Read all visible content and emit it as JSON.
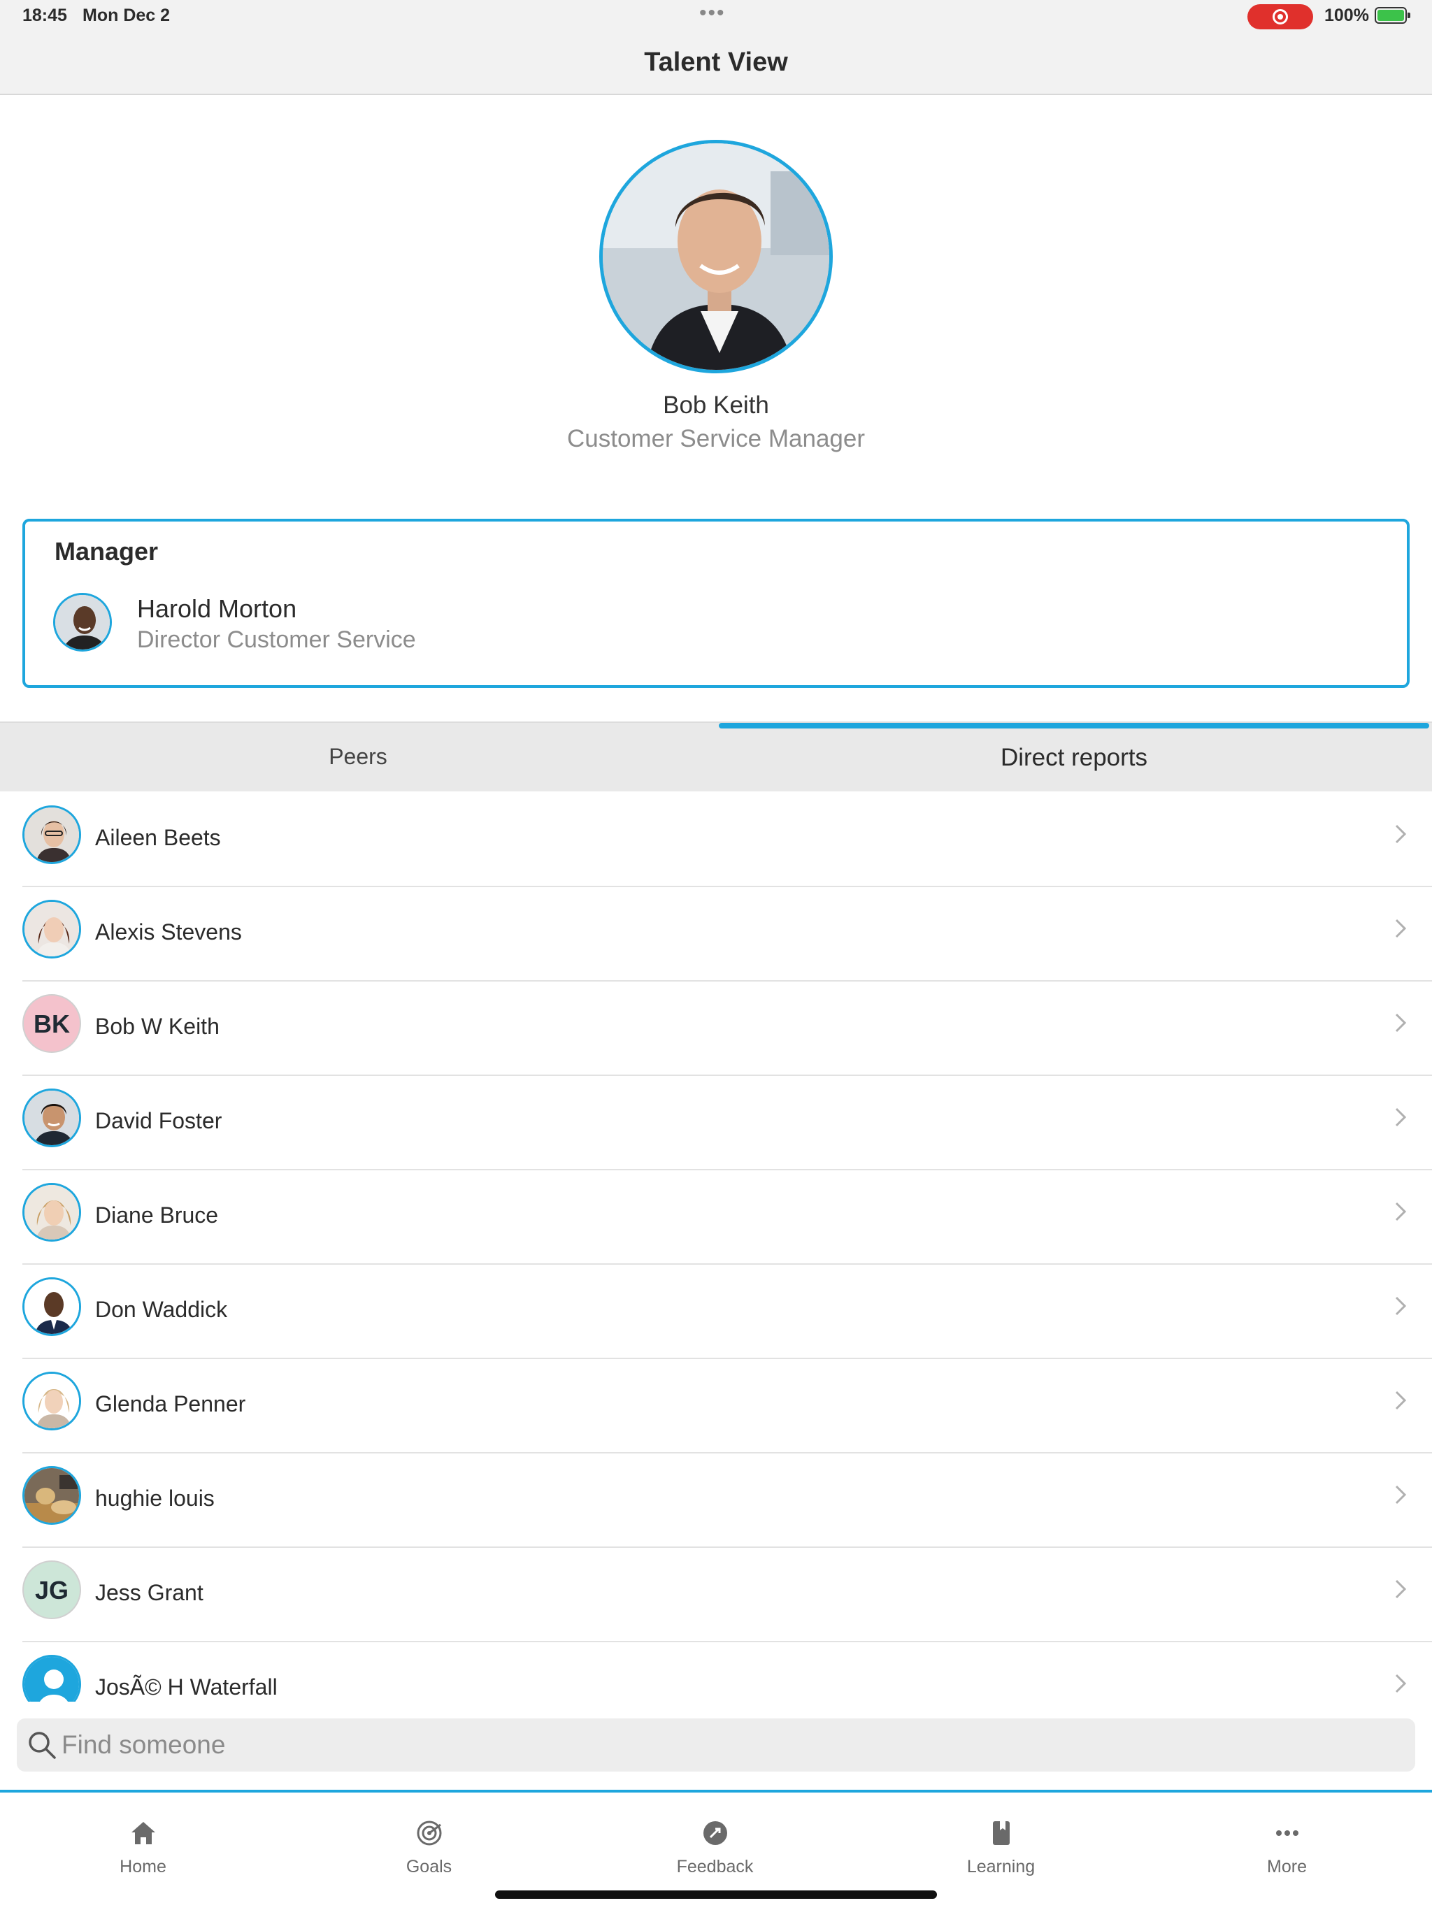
{
  "status_bar": {
    "time": "18:45",
    "date": "Mon Dec 2",
    "battery": "100%"
  },
  "header": {
    "title": "Talent View"
  },
  "profile": {
    "name": "Bob Keith",
    "role": "Customer Service Manager"
  },
  "manager": {
    "heading": "Manager",
    "name": "Harold Morton",
    "role": "Director Customer Service"
  },
  "tabs": {
    "peers": "Peers",
    "direct_reports": "Direct reports",
    "active": "Direct reports"
  },
  "direct_reports": [
    {
      "name": "Aileen Beets",
      "avatar": "photo"
    },
    {
      "name": "Alexis Stevens",
      "avatar": "photo"
    },
    {
      "name": "Bob W Keith",
      "avatar": "initials",
      "initials": "BK",
      "color": "#f4c2cc"
    },
    {
      "name": "David Foster",
      "avatar": "photo"
    },
    {
      "name": "Diane Bruce",
      "avatar": "photo"
    },
    {
      "name": "Don Waddick",
      "avatar": "photo"
    },
    {
      "name": "Glenda Penner",
      "avatar": "photo"
    },
    {
      "name": "hughie louis",
      "avatar": "photo"
    },
    {
      "name": "Jess Grant",
      "avatar": "initials",
      "initials": "JG",
      "color": "#cde6d8"
    },
    {
      "name": "JosÃ© H Waterfall",
      "avatar": "placeholder"
    }
  ],
  "search": {
    "placeholder": "Find someone"
  },
  "bottom_nav": {
    "home": "Home",
    "goals": "Goals",
    "feedback": "Feedback",
    "learning": "Learning",
    "more": "More"
  },
  "colors": {
    "accent": "#1ea6dd",
    "record": "#e0302c"
  }
}
